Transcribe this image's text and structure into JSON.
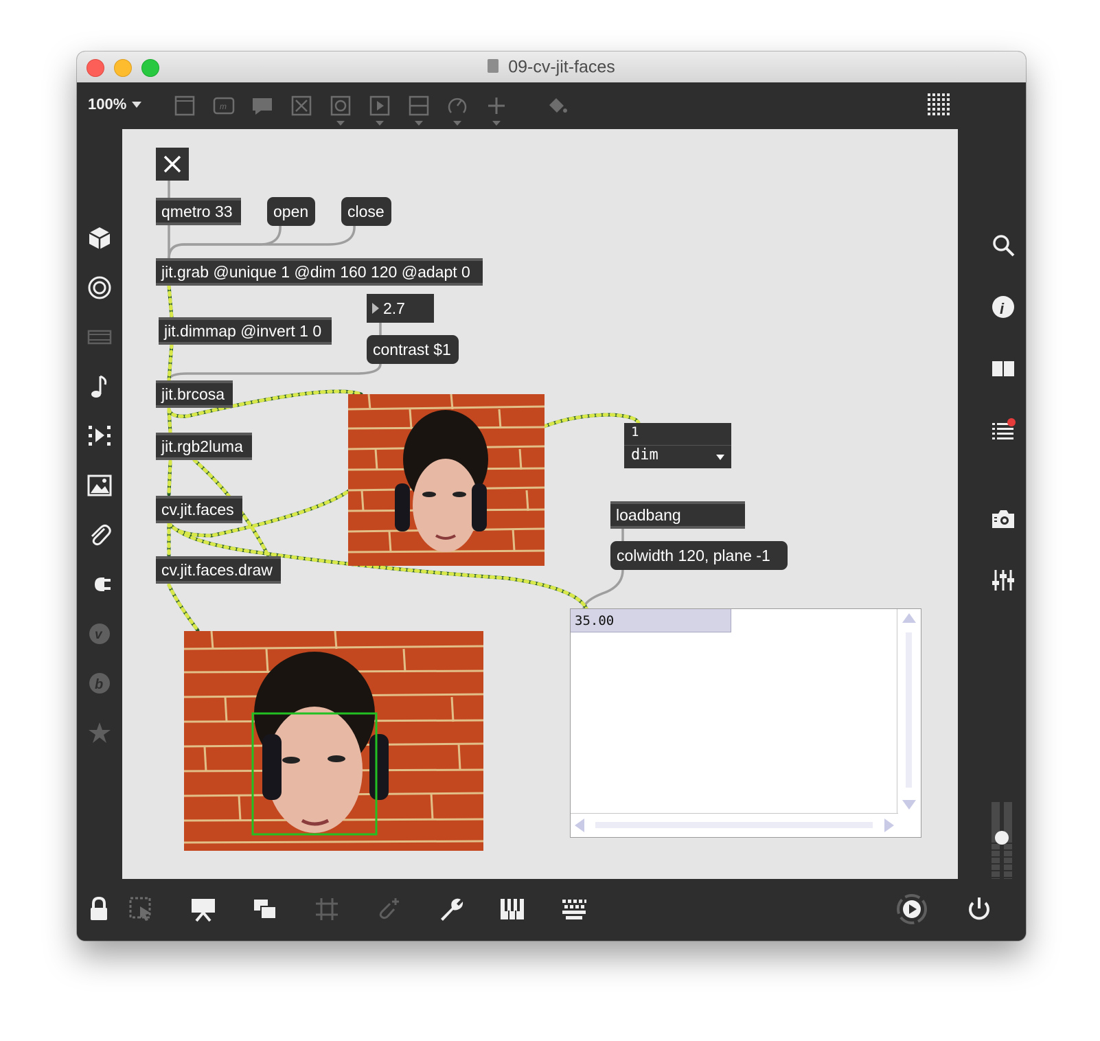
{
  "window": {
    "title": "09-cv-jit-faces"
  },
  "toolbar": {
    "zoom": "100%"
  },
  "patch": {
    "objects": {
      "qmetro": "qmetro 33",
      "grab": "jit.grab @unique 1 @dim 160 120 @adapt 0",
      "dimmap": "jit.dimmap @invert 1 0",
      "brcosa": "jit.brcosa",
      "rgb2luma": "jit.rgb2luma",
      "faces": "cv.jit.faces",
      "facesdraw": "cv.jit.faces.draw",
      "loadbang": "loadbang"
    },
    "messages": {
      "open": "open",
      "close": "close",
      "contrast": "contrast $1",
      "colwidth": "colwidth 120, plane -1"
    },
    "number_value": "2.7",
    "attrui": {
      "value": "1",
      "attribute": "dim"
    },
    "cellblock": {
      "cell_value": "35.00"
    }
  },
  "icons": {
    "left": [
      "cube-icon",
      "target-icon",
      "media-icon",
      "music-note-icon",
      "video-icon",
      "image-icon",
      "paperclip-icon",
      "plug-icon",
      "vst-icon",
      "bpatcher-icon",
      "star-icon"
    ],
    "right": [
      "search-icon",
      "info-icon",
      "book-icon",
      "list-icon",
      "camera-icon",
      "mixer-icon"
    ],
    "bottom": [
      "lock-icon",
      "select-icon",
      "presentation-icon",
      "windows-icon",
      "grid-icon",
      "paperclip-add-icon",
      "wrench-icon",
      "piano-icon",
      "keyboard-icon",
      "play-icon",
      "power-icon"
    ]
  },
  "colors": {
    "patch_bg": "#e5e5e5",
    "object_bg": "#333333",
    "signal_wire": "#2e7d32",
    "face_box": "#22c022"
  }
}
